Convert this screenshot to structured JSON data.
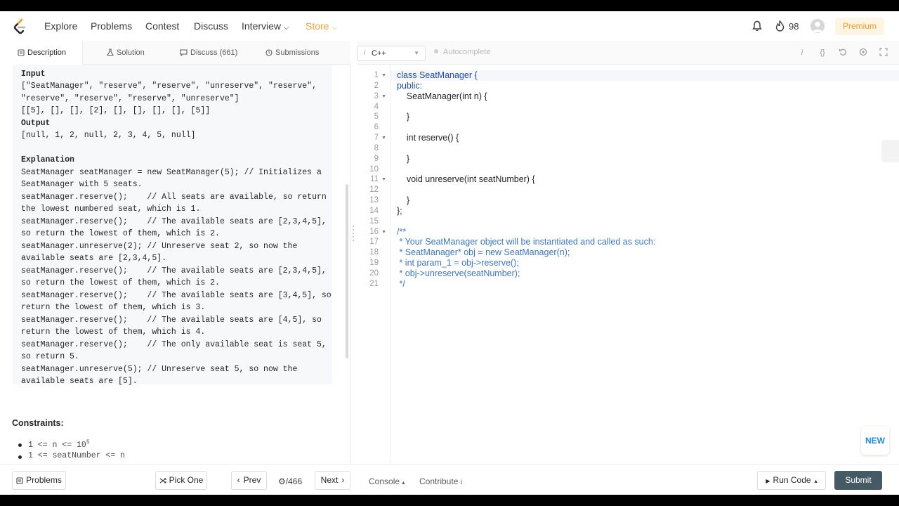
{
  "nav": {
    "items": [
      "Explore",
      "Problems",
      "Contest",
      "Discuss",
      "Interview",
      "Store"
    ],
    "streak": "98",
    "premium": "Premium"
  },
  "tabs": [
    "Description",
    "Solution",
    "Discuss (661)",
    "Submissions"
  ],
  "example": {
    "input_label": "Input",
    "input_lines": [
      "[\"SeatManager\", \"reserve\", \"reserve\", \"unreserve\", \"reserve\",",
      "\"reserve\", \"reserve\", \"reserve\", \"unreserve\"]",
      "[[5], [], [], [2], [], [], [], [], [5]]"
    ],
    "output_label": "Output",
    "output_line": "[null, 1, 2, null, 2, 3, 4, 5, null]",
    "explanation_label": "Explanation",
    "explanation_lines": [
      "SeatManager seatManager = new SeatManager(5); // Initializes a",
      "SeatManager with 5 seats.",
      "seatManager.reserve();    // All seats are available, so return",
      "the lowest numbered seat, which is 1.",
      "seatManager.reserve();    // The available seats are [2,3,4,5],",
      "so return the lowest of them, which is 2.",
      "seatManager.unreserve(2); // Unreserve seat 2, so now the",
      "available seats are [2,3,4,5].",
      "seatManager.reserve();    // The available seats are [2,3,4,5],",
      "so return the lowest of them, which is 2.",
      "seatManager.reserve();    // The available seats are [3,4,5], so",
      "return the lowest of them, which is 3.",
      "seatManager.reserve();    // The available seats are [4,5], so",
      "return the lowest of them, which is 4.",
      "seatManager.reserve();    // The only available seat is seat 5,",
      "so return 5.",
      "seatManager.unreserve(5); // Unreserve seat 5, so now the",
      "available seats are [5]."
    ]
  },
  "constraints": {
    "title": "Constraints:",
    "c1_base": "1 <= n <= 10",
    "c1_exp": "5",
    "c2": "1 <= seatNumber <= n"
  },
  "editor": {
    "language": "C++",
    "autocomplete": "Autocomplete",
    "line_numbers": [
      "1",
      "2",
      "3",
      "4",
      "5",
      "6",
      "7",
      "8",
      "9",
      "10",
      "11",
      "12",
      "13",
      "14",
      "15",
      "16",
      "17",
      "18",
      "19",
      "20",
      "21"
    ],
    "lines": [
      "class SeatManager {",
      "public:",
      "    SeatManager(int n) {",
      "",
      "    }",
      "",
      "    int reserve() {",
      "",
      "    }",
      "",
      "    void unreserve(int seatNumber) {",
      "",
      "    }",
      "};",
      "",
      "/**",
      " * Your SeatManager object will be instantiated and called as such:",
      " * SeatManager* obj = new SeatManager(n);",
      " * int param_1 = obj->reserve();",
      " * obj->unreserve(seatNumber);",
      " */"
    ],
    "new_badge": "NEW"
  },
  "bottom": {
    "problems": "Problems",
    "pick_one": "Pick One",
    "prev": "Prev",
    "counter": "/466",
    "next": "Next",
    "console": "Console",
    "contribute": "Contribute",
    "run_code": "Run Code",
    "submit": "Submit"
  },
  "colors": {
    "accent": "#e9a33a",
    "premium": "#ee9b25",
    "submit_bg": "#455a64",
    "keyword": "#1f4ab0",
    "comment": "#3c76c6"
  }
}
